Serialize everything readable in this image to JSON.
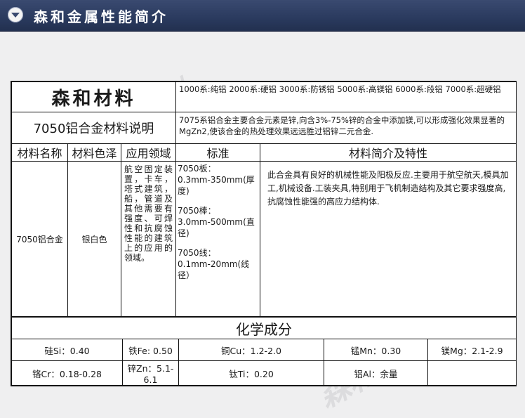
{
  "header": {
    "title": "森和金属性能简介"
  },
  "watermark": {
    "text": "森和金属材料"
  },
  "brand": "森和材料",
  "series_info": "1000系:纯铝 2000系:硬铝 3000系:防锈铝 5000系:高镁铝 6000系:段铝 7000系:超硬铝",
  "product_title": "7050铝合金材料说明",
  "product_desc": "7075系铝合金主要合金元素是锌,向含3%-75%锌的合金中添加镁,可以形成强化效果显著的MgZn2,使该合金的热处理效果远远胜过铝锌二元合金.",
  "columns": {
    "name": "材料名称",
    "color": "材料色泽",
    "application": "应用领域",
    "standard": "标准",
    "intro": "材料简介及特性"
  },
  "material": {
    "name": "7050铝合金",
    "color": "银白色",
    "application": "航空固定装置，卡车，塔式建筑，船，管道及其他需要有强度、可焊性和抗腐蚀性能的建筑上的应用的领域。",
    "standards": [
      {
        "label": "7050板：",
        "value": "0.3mm-350mm(厚度)"
      },
      {
        "label": "7050棒：",
        "value": "3.0mm-500mm(直径)"
      },
      {
        "label": "7050线：",
        "value": "0.1mm-20mm(线径）"
      }
    ],
    "intro": "此合金具有良好的机械性能及阳极反应.主要用于航空航天,模具加工,机械设备.工装夹具,特别用于飞机制造结构及其它要求强度高,抗腐蚀性能强的高应力结构体."
  },
  "chemistry": {
    "title": "化学成分",
    "row1": [
      "硅Si：0.40",
      "铁Fe: 0.50",
      "铜Cu：1.2-2.0",
      "锰Mn：0.30",
      "镁Mg：2.1-2.9"
    ],
    "row2": [
      "铬Cr：0.18-0.28",
      "锌Zn：5.1-6.1",
      "钛Ti：0.20",
      "铝Al：余量",
      ""
    ]
  }
}
